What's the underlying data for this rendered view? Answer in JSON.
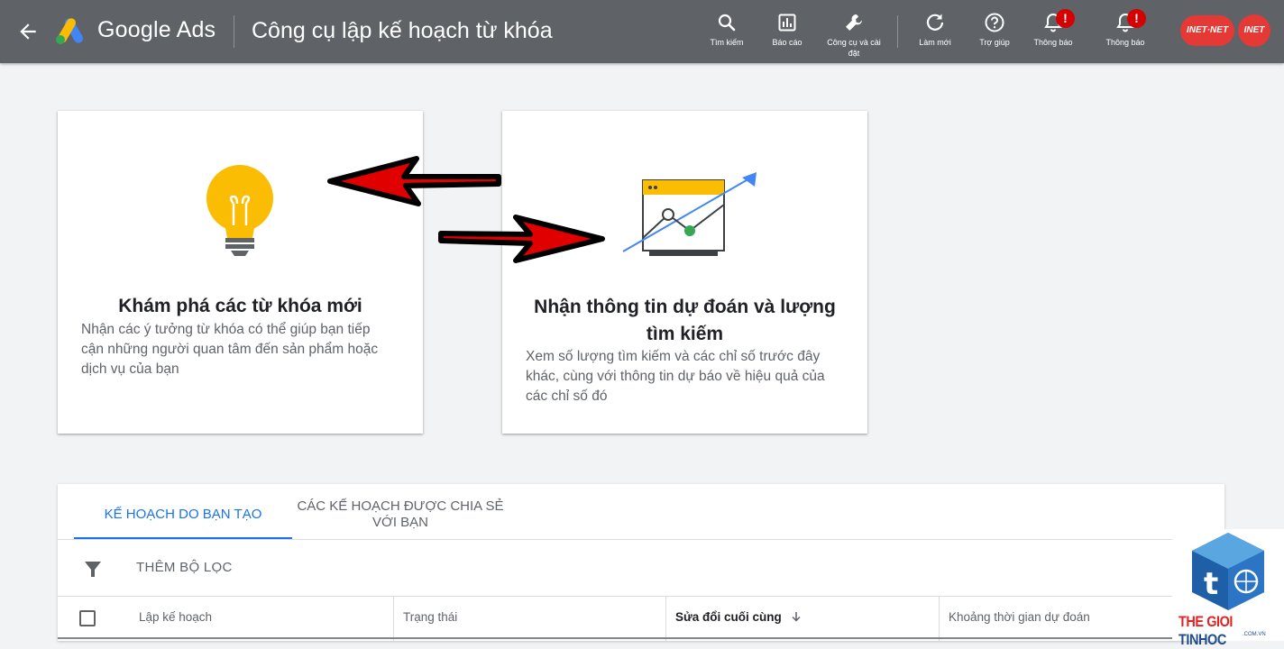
{
  "header": {
    "brand": "Google Ads",
    "title": "Công cụ lập kế hoạch từ khóa",
    "tools": [
      {
        "label": "Tìm kiếm",
        "icon": "search-icon"
      },
      {
        "label": "Báo cáo",
        "icon": "reports-icon"
      },
      {
        "label": "Công cụ và cài đặt",
        "icon": "wrench-icon"
      },
      {
        "label": "Làm mới",
        "icon": "refresh-icon"
      },
      {
        "label": "Trợ giúp",
        "icon": "help-icon"
      },
      {
        "label": "Thông báo",
        "icon": "bell-icon",
        "badge": "!"
      },
      {
        "label": "Thông báo",
        "icon": "bell-icon",
        "badge": "!"
      }
    ],
    "accounts": [
      "INET·NET",
      "INET"
    ]
  },
  "cards": [
    {
      "title": "Khám phá các từ khóa mới",
      "desc": "Nhận các ý tưởng từ khóa có thể giúp bạn tiếp cận những người quan tâm đến sản phẩm hoặc dịch vụ của bạn",
      "icon": "lightbulb-icon"
    },
    {
      "title": "Nhận thông tin dự đoán và lượng tìm kiếm",
      "desc": "Xem số lượng tìm kiếm và các chỉ số trước đây khác, cùng với thông tin dự báo về hiệu quả của các chỉ số đó",
      "icon": "forecast-chart-icon"
    }
  ],
  "plans": {
    "tabs": [
      "KẾ HOẠCH DO BẠN TẠO",
      "CÁC KẾ HOẠCH ĐƯỢC CHIA SẺ VỚI BẠN"
    ],
    "filter_label": "THÊM BỘ LỌC",
    "columns": [
      "Lập kế hoạch",
      "Trạng thái",
      "Sửa đổi cuối cùng",
      "Khoảng thời gian dự đoán"
    ],
    "sort_column": "Sửa đổi cuối cùng"
  },
  "watermark": {
    "red": "THE GIOI ",
    "blue": "TINHOC",
    "domain": ".COM.VN"
  },
  "colors": {
    "header_bg": "#5f6368",
    "accent": "#1a73e8",
    "badge": "#d50000",
    "bulb": "#fbbc04",
    "arrow_fill": "#e00000"
  }
}
